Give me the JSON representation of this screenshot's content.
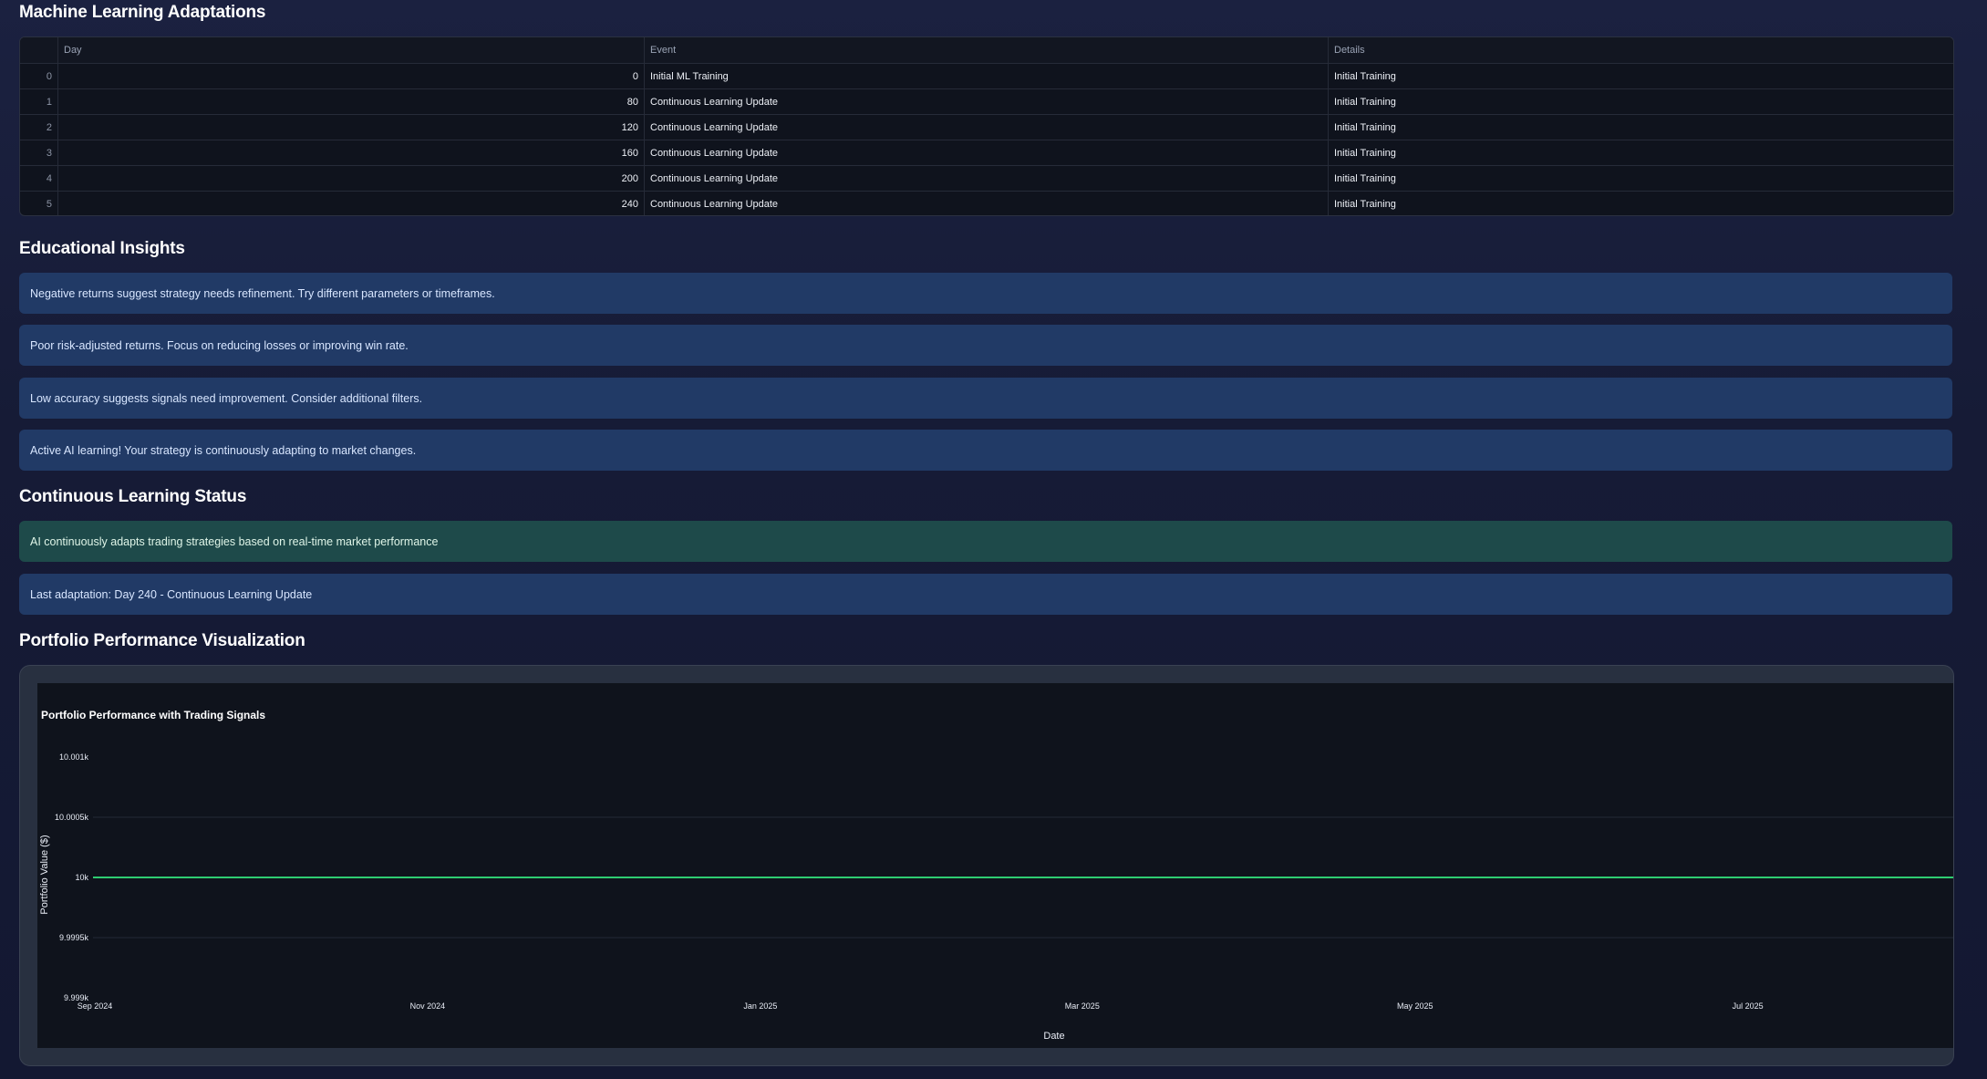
{
  "ml_section": {
    "title": "Machine Learning Adaptations",
    "columns": [
      "",
      "Day",
      "Event",
      "Details"
    ],
    "rows": [
      {
        "index": "0",
        "day": "0",
        "event": "Initial ML Training",
        "details": "Initial Training"
      },
      {
        "index": "1",
        "day": "80",
        "event": "Continuous Learning Update",
        "details": "Initial Training"
      },
      {
        "index": "2",
        "day": "120",
        "event": "Continuous Learning Update",
        "details": "Initial Training"
      },
      {
        "index": "3",
        "day": "160",
        "event": "Continuous Learning Update",
        "details": "Initial Training"
      },
      {
        "index": "4",
        "day": "200",
        "event": "Continuous Learning Update",
        "details": "Initial Training"
      },
      {
        "index": "5",
        "day": "240",
        "event": "Continuous Learning Update",
        "details": "Initial Training"
      }
    ]
  },
  "insights": {
    "title": "Educational Insights",
    "items": [
      "Negative returns suggest strategy needs refinement. Try different parameters or timeframes.",
      "Poor risk-adjusted returns. Focus on reducing losses or improving win rate.",
      "Low accuracy suggests signals need improvement. Consider additional filters.",
      "Active AI learning! Your strategy is continuously adapting to market changes."
    ]
  },
  "learning_status": {
    "title": "Continuous Learning Status",
    "success_message": "AI continuously adapts trading strategies based on real-time market performance",
    "info_message": "Last adaptation: Day 240 - Continuous Learning Update"
  },
  "visualization": {
    "title": "Portfolio Performance Visualization"
  },
  "colors": {
    "line": "#2ecc71",
    "info_bg": "#213a66",
    "success_bg": "#1e4a4a",
    "plot_bg": "#0f131c"
  },
  "chart_data": {
    "type": "line",
    "title": "Portfolio Performance with Trading Signals",
    "xlabel": "Date",
    "ylabel": "Portfolio Value ($)",
    "x_ticks": [
      "Sep 2024",
      "Nov 2024",
      "Jan 2025",
      "Mar 2025",
      "May 2025",
      "Jul 2025"
    ],
    "y_ticks": [
      "10.001k",
      "10.0005k",
      "10k",
      "9.9995k",
      "9.999k"
    ],
    "ylim": [
      9999,
      10001
    ],
    "grid": true,
    "series": [
      {
        "x": [
          "2024-09-01",
          "2025-07-31"
        ],
        "values": [
          10000,
          10000
        ]
      }
    ]
  }
}
